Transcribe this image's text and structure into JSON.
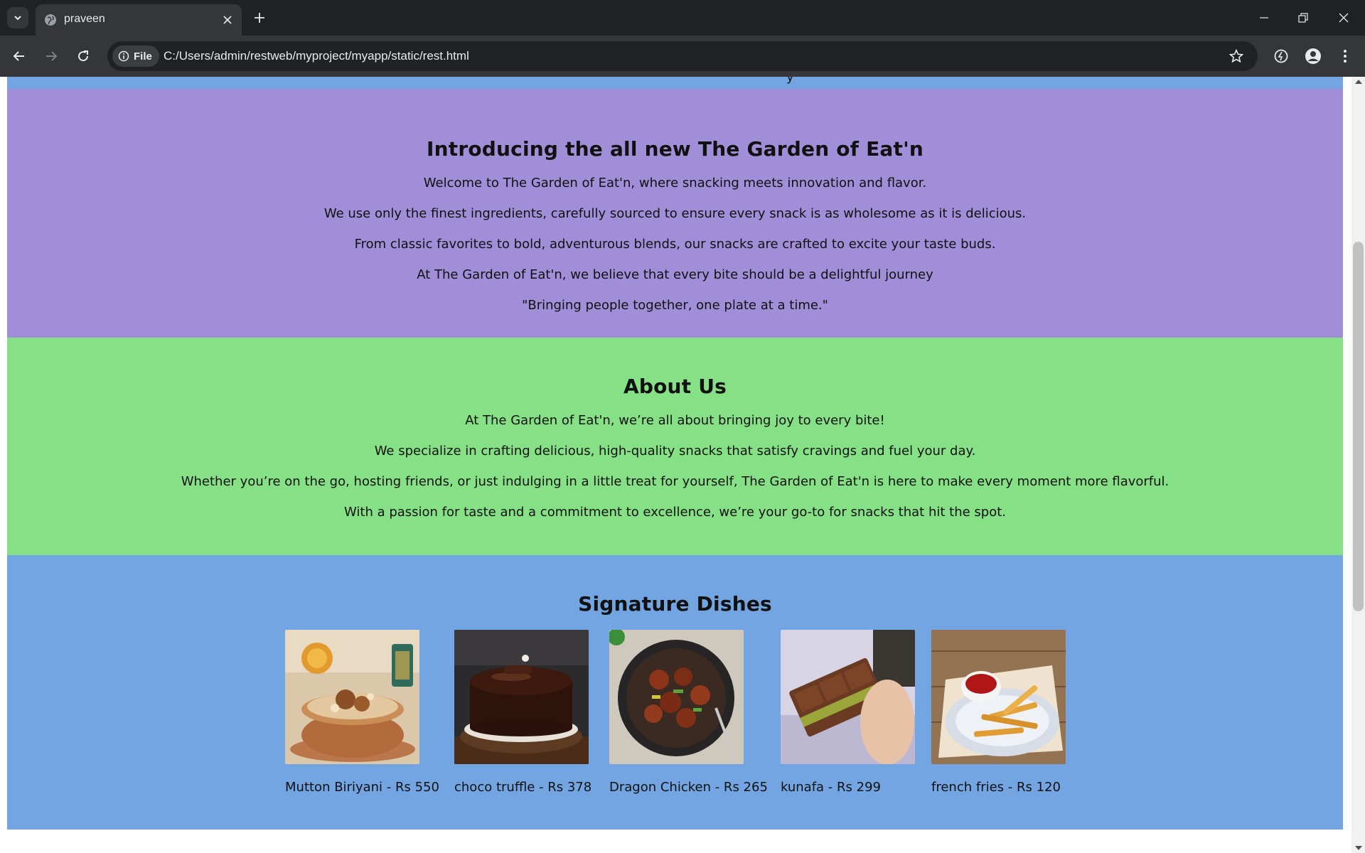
{
  "browser": {
    "tab_title": "praveen",
    "chip_label": "File",
    "url": "C:/Users/admin/restweb/myproject/myapp/static/rest.html"
  },
  "page": {
    "intro": {
      "heading": "Introducing the all new The Garden of Eat'n",
      "paragraphs": [
        "Welcome to The Garden of Eat'n, where snacking meets innovation and flavor.",
        "We use only the finest ingredients, carefully sourced to ensure every snack is as wholesome as it is delicious.",
        "From classic favorites to bold, adventurous blends, our snacks are crafted to excite your taste buds.",
        "At The Garden of Eat'n, we believe that every bite should be a delightful journey",
        "\"Bringing people together, one plate at a time.\""
      ]
    },
    "about": {
      "heading": "About Us",
      "paragraphs": [
        "At The Garden of Eat'n, we’re all about bringing joy to every bite!",
        "We specialize in crafting delicious, high-quality snacks that satisfy cravings and fuel your day.",
        "Whether you’re on the go, hosting friends, or just indulging in a little treat for yourself, The Garden of Eat'n is here to make every moment more flavorful.",
        "With a passion for taste and a commitment to excellence, we’re your go-to for snacks that hit the spot."
      ]
    },
    "dishes": {
      "heading": "Signature Dishes",
      "items": [
        {
          "caption": "Mutton Biriyani - Rs 550",
          "image": "biryani-photo"
        },
        {
          "caption": "choco truffle - Rs 378",
          "image": "chocolate-cake-photo"
        },
        {
          "caption": "Dragon Chicken - Rs 265",
          "image": "dragon-chicken-photo"
        },
        {
          "caption": "kunafa - Rs 299",
          "image": "kunafa-chocolate-photo"
        },
        {
          "caption": "french fries - Rs 120",
          "image": "french-fries-photo"
        }
      ]
    }
  },
  "colors": {
    "intro_bg": "#a08fd8",
    "about_bg": "#86e085",
    "dishes_bg": "#72a5e1"
  }
}
